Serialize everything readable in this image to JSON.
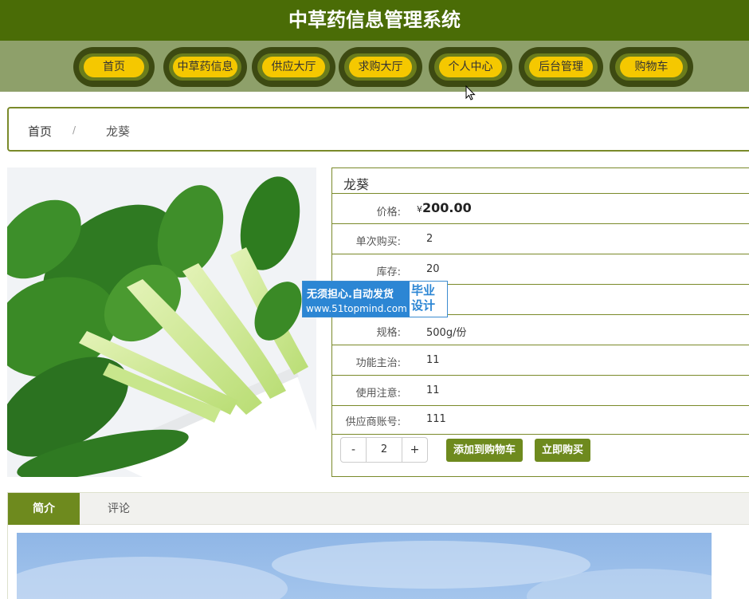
{
  "site": {
    "title": "中草药信息管理系统"
  },
  "nav": {
    "items": [
      {
        "label": "首页"
      },
      {
        "label": "中草药信息"
      },
      {
        "label": "供应大厅"
      },
      {
        "label": "求购大厅"
      },
      {
        "label": "个人中心"
      },
      {
        "label": "后台管理"
      },
      {
        "label": "购物车"
      }
    ]
  },
  "breadcrumb": {
    "home": "首页",
    "separator": "/",
    "current": "龙葵"
  },
  "product": {
    "name": "龙葵",
    "price_symbol": "¥",
    "price": "200.00",
    "fields": [
      {
        "label": "价格:"
      },
      {
        "label": "单次购买:",
        "value": "2"
      },
      {
        "label": "库存:",
        "value": "20"
      },
      {
        "label": "规格:",
        "value": "500g/份"
      },
      {
        "label": "功能主治:",
        "value": "11"
      },
      {
        "label": "使用注意:",
        "value": "11"
      },
      {
        "label": "供应商账号:",
        "value": "111"
      }
    ],
    "quantity": {
      "minus": "-",
      "value": "2",
      "plus": "+"
    },
    "add_to_cart": "添加到购物车",
    "buy_now": "立即购买"
  },
  "watermark": {
    "line1": "无须担心.自动发货",
    "line2": "www.51topmind.com",
    "side1": "毕业",
    "side2": "设计"
  },
  "tabs": [
    {
      "label": "简介"
    },
    {
      "label": "评论"
    }
  ],
  "colors": {
    "header": "#4a6c06",
    "nav_bar": "#8ea06a",
    "nav_pill": "#f5c800",
    "accent": "#6e8a1e",
    "border": "#7a8a2a"
  }
}
